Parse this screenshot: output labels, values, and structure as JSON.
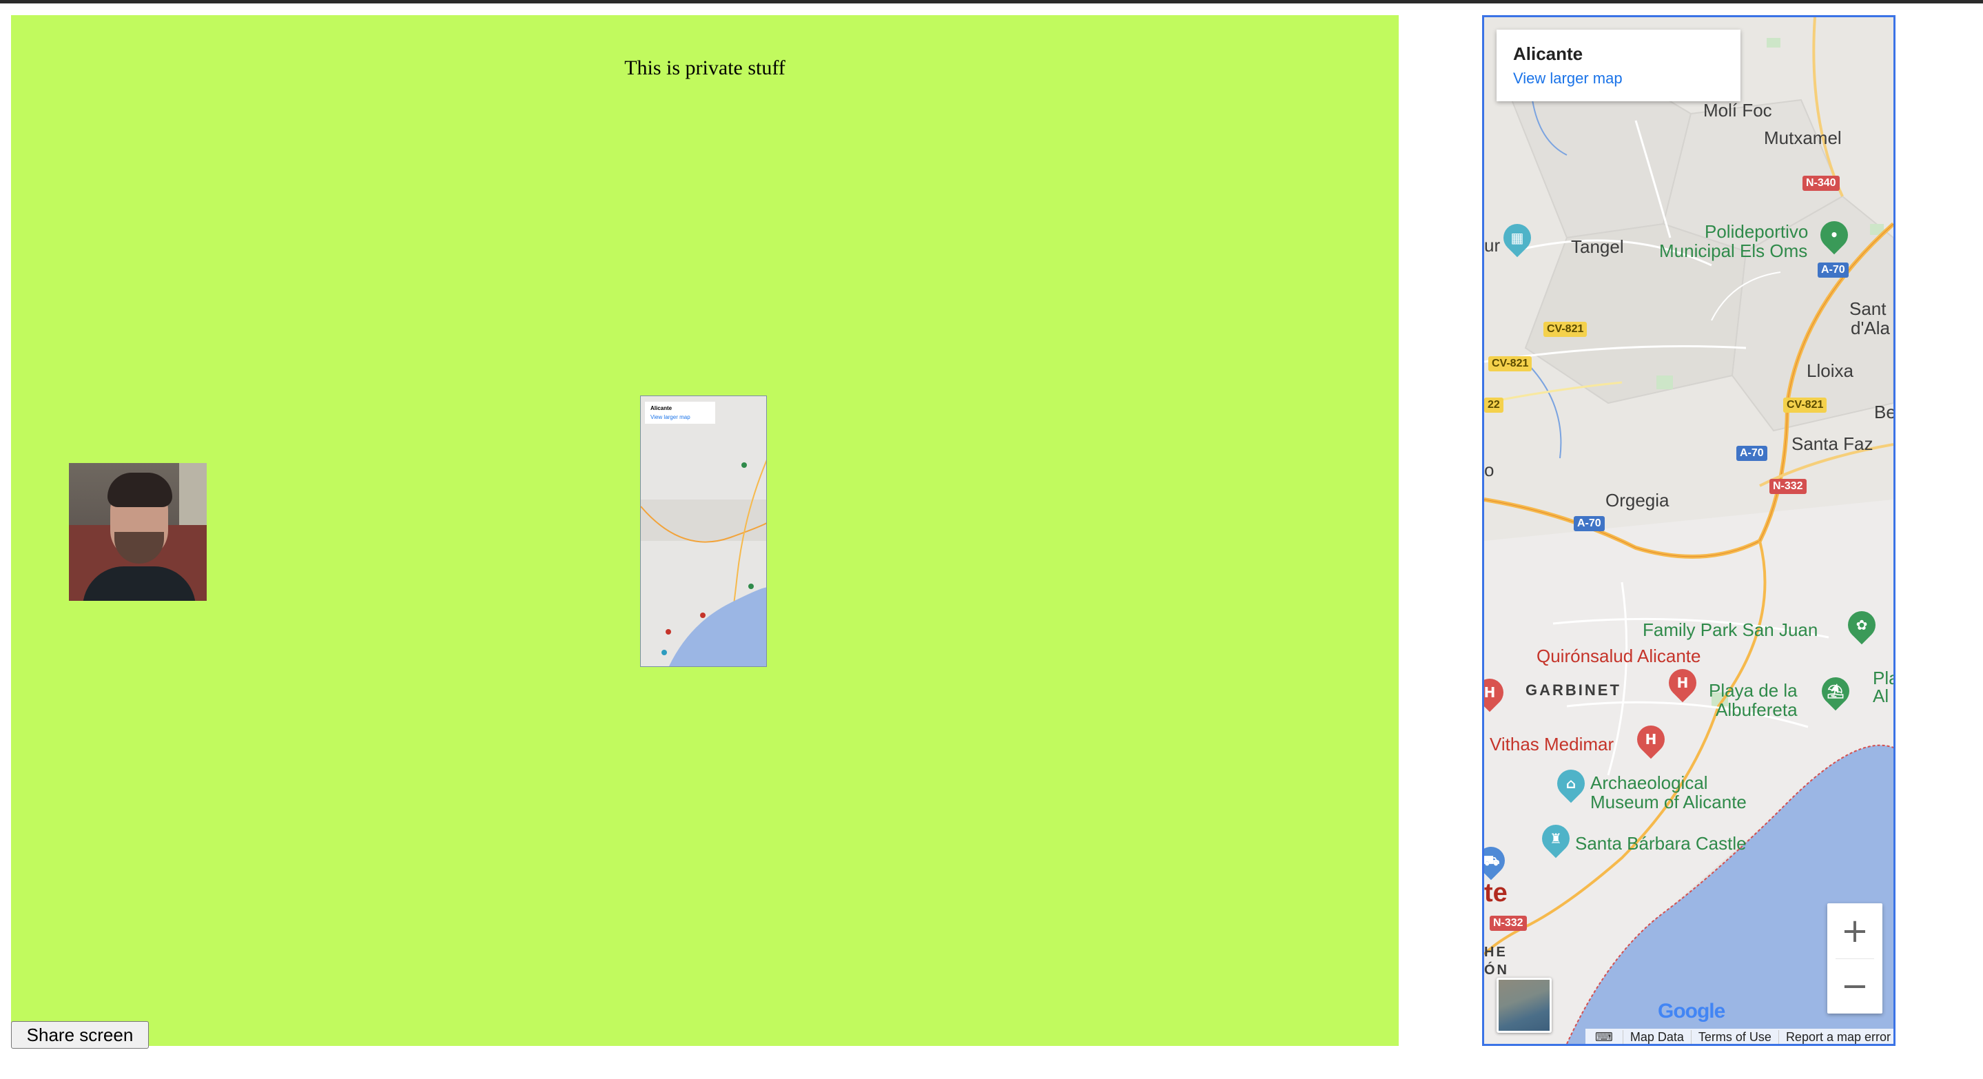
{
  "stage": {
    "text": "This is private stuff",
    "background": "#c1fa5e"
  },
  "toolbar": {
    "share_label": "Share screen"
  },
  "map": {
    "info_card": {
      "title": "Alicante",
      "link": "View larger map"
    },
    "places": {
      "moli_foc": "Molí Foc",
      "mutxamel": "Mutxamel",
      "tangel": "Tangel",
      "polideportivo_line1": "Polideportivo",
      "polideportivo_line2": "Municipal Els Oms",
      "sant_line1": "Sant",
      "sant_line2": "d'Ala",
      "lloixa": "Lloixa",
      "santa_faz": "Santa Faz",
      "orgegia": "Orgegia",
      "family_park": "Family Park San Juan",
      "quironsalud": "Quirónsalud Alicante",
      "garbinet": "GARBINET",
      "playa_line1": "Playa de la",
      "playa_line2": "Albufereta",
      "vithas": "Vithas Medimar",
      "archaeological_line1": "Archaeological",
      "archaeological_line2": "Museum of Alicante",
      "santa_barbara": "Santa Bárbara Castle",
      "city_fragment": "te",
      "edge_ur": "ur",
      "edge_be": "Be",
      "edge_p": "P",
      "edge_o": "o",
      "edge_pla": "Pla",
      "edge_al": "Al",
      "edge_he": "HE",
      "edge_on": "ÓN"
    },
    "roads": {
      "n340": "N-340",
      "a70_1": "A-70",
      "a70_2": "A-70",
      "a70_3": "A-70",
      "cv821_1": "CV-821",
      "cv821_2": "CV-821",
      "cv821_3": "CV-821",
      "cv822": "22",
      "n332_1": "N-332",
      "n332_2": "N-332"
    },
    "zoom": {
      "in": "+",
      "out": "−"
    },
    "logo": "Google",
    "attribution": {
      "map_data": "Map Data",
      "terms": "Terms of Use",
      "report": "Report a map error"
    },
    "colors": {
      "border": "#3b73e6",
      "water": "#9bb6e4",
      "land": "#e6e4e0",
      "highway": "#f6b94c"
    }
  }
}
